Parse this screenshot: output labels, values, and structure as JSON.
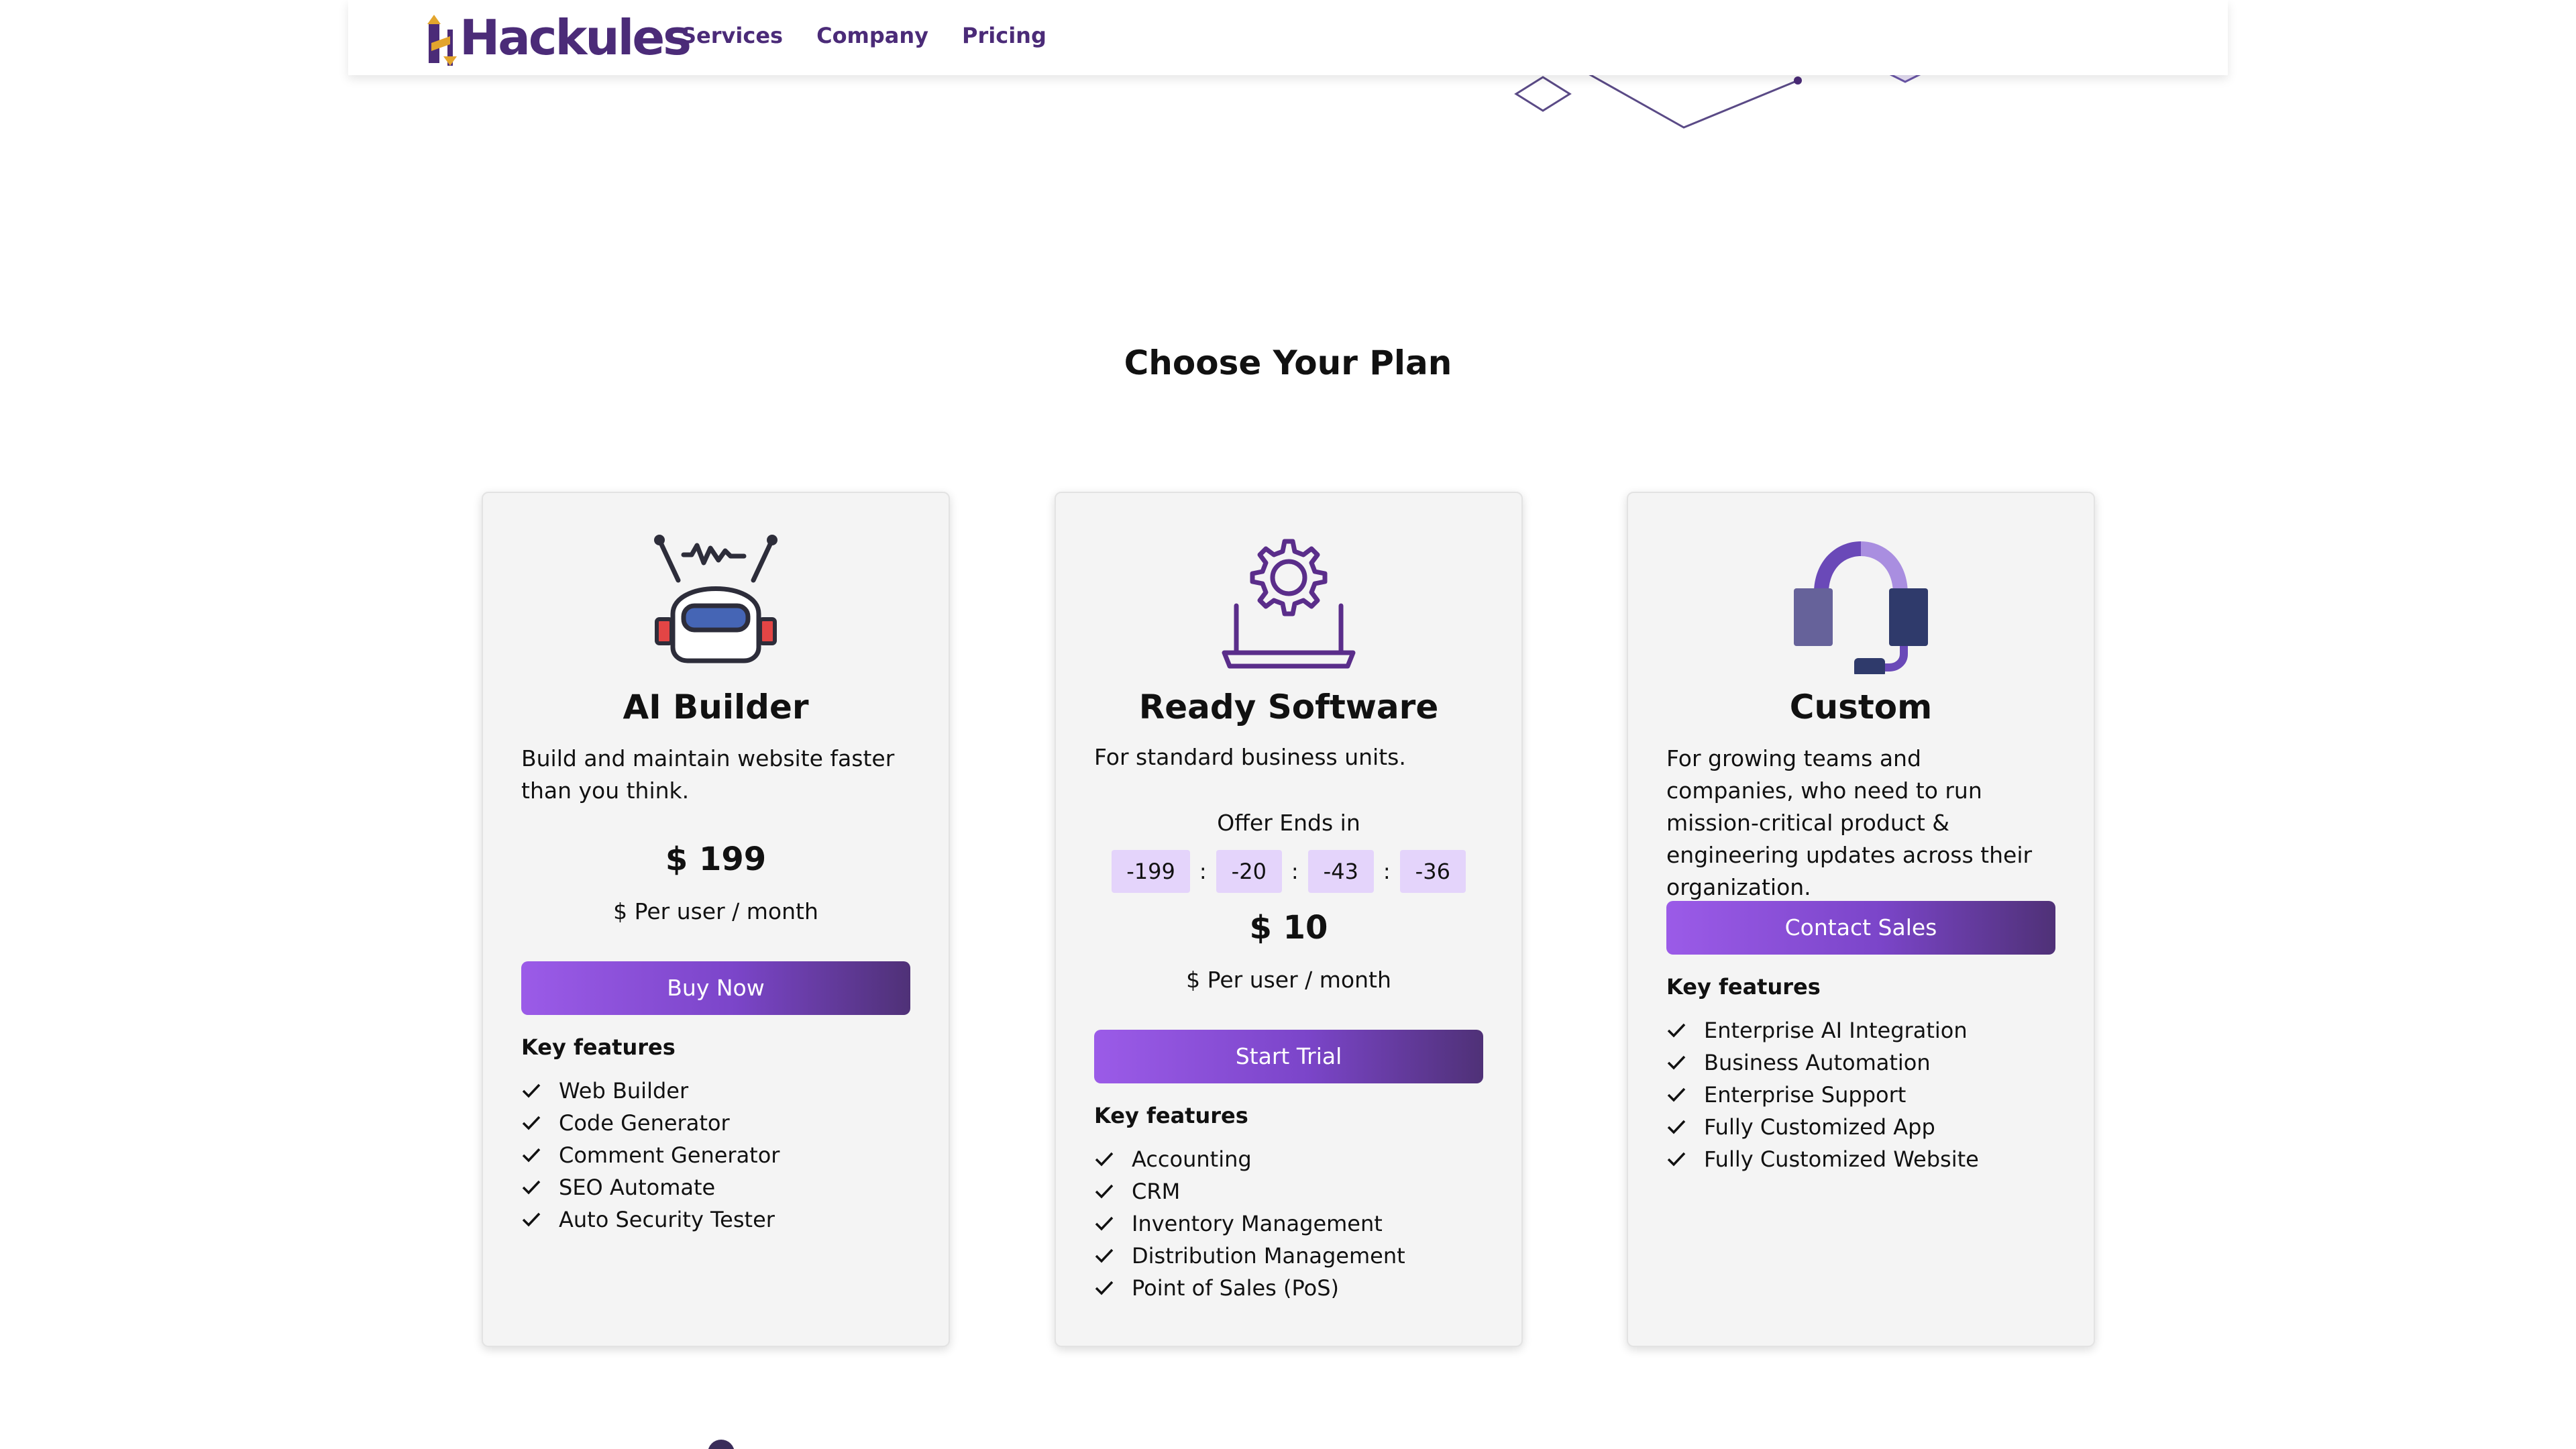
{
  "header": {
    "logo_text": "Hackules",
    "nav": [
      "Services",
      "Company",
      "Pricing"
    ]
  },
  "section_title": "Choose Your Plan",
  "plans": [
    {
      "icon": "robot-icon",
      "name": "AI Builder",
      "description": "Build and maintain website faster than you think.",
      "price": "$ 199",
      "per": "$ Per user / month",
      "button": "Buy Now",
      "key_features_label": "Key features",
      "features": [
        "Web Builder",
        "Code Generator",
        "Comment Generator",
        "SEO Automate",
        "Auto Security Tester"
      ]
    },
    {
      "icon": "laptop-gear-icon",
      "name": "Ready Software",
      "description": "For standard business units.",
      "offer_label": "Offer Ends in",
      "countdown": [
        "-199",
        "-20",
        "-43",
        "-36"
      ],
      "countdown_sep": ":",
      "price": "$ 10",
      "per": "$ Per user / month",
      "button": "Start Trial",
      "key_features_label": "Key features",
      "features": [
        "Accounting",
        "CRM",
        "Inventory Management",
        "Distribution Management",
        "Point of Sales (PoS)"
      ]
    },
    {
      "icon": "headset-icon",
      "name": "Custom",
      "description": "For growing teams and companies, who need to run mission-critical product & engineering updates across their organization.",
      "button": "Contact Sales",
      "key_features_label": "Key features",
      "features": [
        "Enterprise AI Integration",
        "Business Automation",
        "Enterprise Support",
        "Fully Customized App",
        "Fully Customized Website"
      ]
    }
  ],
  "colors": {
    "brand": "#4b2b78",
    "button_start": "#9b5be8",
    "button_end": "#4f3177",
    "countdown_bg": "#e4d4fb",
    "card_bg": "#f4f4f4"
  }
}
